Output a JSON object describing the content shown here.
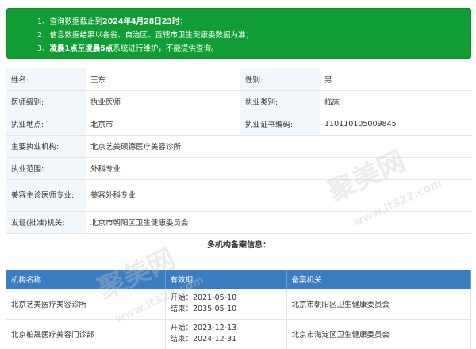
{
  "notice": {
    "line1_prefix": "1、查询数据截止到",
    "line1_bold": "2024年4月28日23时",
    "line1_suffix": "；",
    "line2": "2、信息数据结果以各省、自治区、直辖市卫生健康委数据为准；",
    "line3_prefix": "3、",
    "line3_bold1": "凌晨1点",
    "line3_mid": "至",
    "line3_bold2": "凌晨5点",
    "line3_suffix": "系统进行维护，不能提供查询。"
  },
  "info": {
    "name_label": "姓名:",
    "name": "王东",
    "gender_label": "性别:",
    "gender": "男",
    "level_label": "医师级别:",
    "level": "执业医师",
    "category_label": "执业类别:",
    "category": "临床",
    "location_label": "执业地点:",
    "location": "北京市",
    "cert_label": "执业证书编码:",
    "cert": "110110105009845",
    "org_label": "主要执业机构:",
    "org": "北京艺美硕德医疗美容诊所",
    "scope_label": "执业范围:",
    "scope": "外科专业",
    "cosmetic_label": "美容主诊医师专业:",
    "cosmetic": "美容外科专业",
    "authority_label": "发证(批准)机关:",
    "authority": "北京市朝阳区卫生健康委员会"
  },
  "section_title": "多机构备案信息：",
  "org_table": {
    "headers": [
      "机构名称",
      "有效期",
      "备案机关"
    ],
    "rows": [
      {
        "name": "北京艺美医疗美容诊所",
        "start": "开始：2021-05-10",
        "end": "结束：2035-05-10",
        "authority": "北京市朝阳区卫生健康委员会"
      },
      {
        "name": "北京柏晟医疗美容门诊部",
        "start": "开始：2023-12-13",
        "end": "结束：2024-12-31",
        "authority": "北京市海淀区卫生健康委员会"
      }
    ]
  },
  "watermark": {
    "text1": "聚美网",
    "text2": "www.it322.com"
  }
}
